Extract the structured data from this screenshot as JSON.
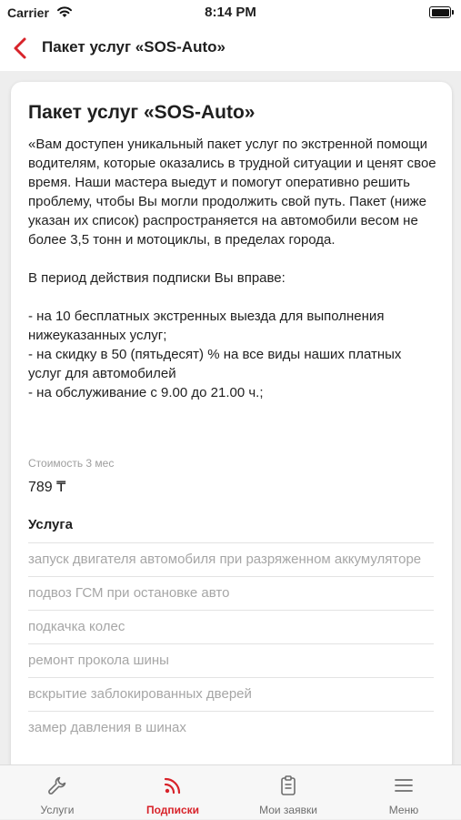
{
  "status_bar": {
    "carrier": "Carrier",
    "time": "8:14 PM"
  },
  "nav": {
    "title": "Пакет услуг «SOS-Auto»"
  },
  "card": {
    "title": "Пакет услуг «SOS-Auto»",
    "description": "«Вам доступен уникальный пакет услуг по экстренной помощи водителям, которые оказались в трудной ситуации и ценят свое время. Наши мастера выедут и помогут оперативно решить проблему, чтобы Вы могли продолжить свой путь. Пакет (ниже указан их список) распространяется на автомобили весом не более 3,5 тонн и мотоциклы, в пределах города.\n\nВ период действия подписки Вы вправе:\n\n- на 10 бесплатных экстренных выезда для выполнения нижеуказанных услуг;\n- на скидку в 50 (пятьдесят) % на все виды наших платных услуг для автомобилей\n- на обслуживание с 9.00 до 21.00 ч.;",
    "price_label": "Стоимость 3 мес",
    "price_value": "789 ₸",
    "service_heading": "Услуга",
    "services": [
      "запуск двигателя автомобиля при разряженном аккумуляторе",
      "подвоз ГСМ при остановке авто",
      "подкачка колес",
      "ремонт прокола шины",
      "вскрытие заблокированных дверей",
      "замер давления в шинах"
    ]
  },
  "tabs": [
    {
      "label": "Услуги",
      "icon": "wrench-icon",
      "active": false
    },
    {
      "label": "Подписки",
      "icon": "rss-icon",
      "active": true
    },
    {
      "label": "Мои заявки",
      "icon": "clipboard-icon",
      "active": false
    },
    {
      "label": "Меню",
      "icon": "menu-icon",
      "active": false
    }
  ],
  "colors": {
    "accent": "#d8232a",
    "inactive_tab": "#6e6e6e",
    "muted_text": "#a6a6a6"
  }
}
